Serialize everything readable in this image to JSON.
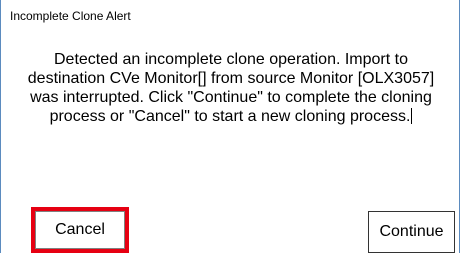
{
  "dialog": {
    "title": "Incomplete Clone Alert",
    "message": "Detected an incomplete clone operation. Import to destination CVe Monitor[] from source Monitor [OLX3057] was interrupted. Click \"Continue\" to complete the cloning process or \"Cancel\" to start a new cloning process."
  },
  "buttons": {
    "cancel_label": "Cancel",
    "continue_label": "Continue"
  },
  "colors": {
    "highlight": "#e60012",
    "window_border": "#5b8bbf"
  }
}
